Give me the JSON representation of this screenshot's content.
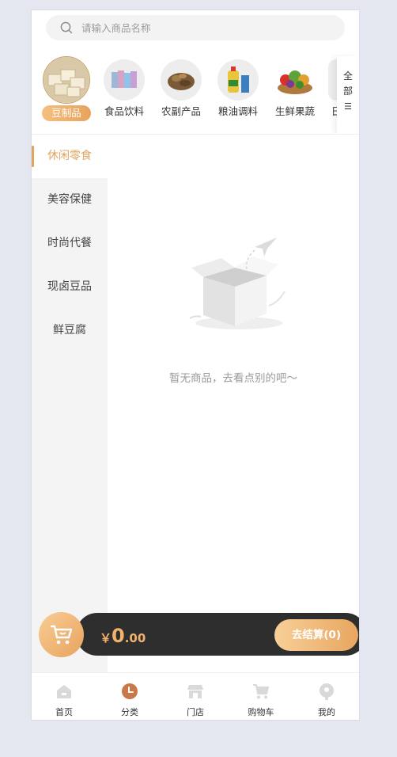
{
  "search": {
    "placeholder": "请输入商品名称",
    "icon": "search-icon"
  },
  "categories": [
    {
      "label": "豆制品",
      "active": true
    },
    {
      "label": "食品饮料",
      "active": false
    },
    {
      "label": "农副产品",
      "active": false
    },
    {
      "label": "粮油调料",
      "active": false
    },
    {
      "label": "生鲜果蔬",
      "active": false
    },
    {
      "label": "日",
      "active": false
    }
  ],
  "all_button": {
    "lines": [
      "全",
      "部",
      "☰"
    ]
  },
  "sidebar": {
    "items": [
      {
        "label": "休闲零食",
        "active": true
      },
      {
        "label": "美容保健",
        "active": false
      },
      {
        "label": "时尚代餐",
        "active": false
      },
      {
        "label": "现卤豆品",
        "active": false
      },
      {
        "label": "鲜豆腐",
        "active": false
      }
    ]
  },
  "empty": {
    "text": "暂无商品，去看点别的吧～"
  },
  "cart": {
    "currency": "￥",
    "amount_int": "0",
    "amount_dec": ".00",
    "checkout_label": "去结算(0)"
  },
  "tabbar": {
    "items": [
      {
        "label": "首页",
        "icon": "home-icon",
        "active": false
      },
      {
        "label": "分类",
        "icon": "category-icon",
        "active": true
      },
      {
        "label": "门店",
        "icon": "store-icon",
        "active": false
      },
      {
        "label": "购物车",
        "icon": "cart-icon",
        "active": false
      },
      {
        "label": "我的",
        "icon": "profile-icon",
        "active": false
      }
    ]
  },
  "colors": {
    "accent": "#e0a45f",
    "dark_bar": "#2e2e2e",
    "background": "#e4e7ef"
  }
}
